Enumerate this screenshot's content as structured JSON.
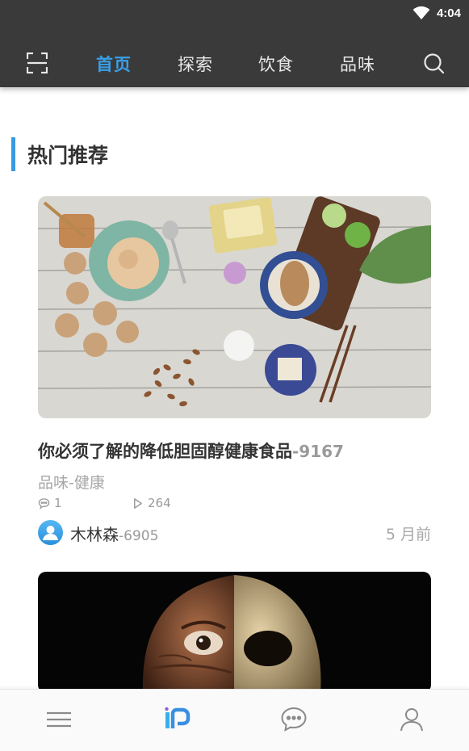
{
  "status_bar": {
    "time": "4:04",
    "icons": [
      "wifi-icon"
    ]
  },
  "top_nav": {
    "left_icon": "scan-icon",
    "tabs": [
      {
        "label": "首页",
        "active": true
      },
      {
        "label": "探索",
        "active": false
      },
      {
        "label": "饮食",
        "active": false
      },
      {
        "label": "品味",
        "active": false
      }
    ],
    "right_icon": "search-icon"
  },
  "section": {
    "title": "热门推荐"
  },
  "articles": [
    {
      "image": "healthy-food-flatlay",
      "title": "你必须了解的降低胆固醇健康食品",
      "title_id": "-9167",
      "category": "品味-健康",
      "comments": "1",
      "plays": "264",
      "author": "木林森",
      "author_id": "-6905",
      "time": "5 月前"
    },
    {
      "image": "ancient-skull-face-reconstruction"
    }
  ],
  "bottom_nav": {
    "items": [
      "menu-icon",
      "discover-icon",
      "message-icon",
      "profile-icon"
    ],
    "active_index": 1
  },
  "colors": {
    "accent": "#3aa0e8",
    "topbar_bg": "#3a3a3a",
    "muted_text": "#a6a6a6"
  }
}
